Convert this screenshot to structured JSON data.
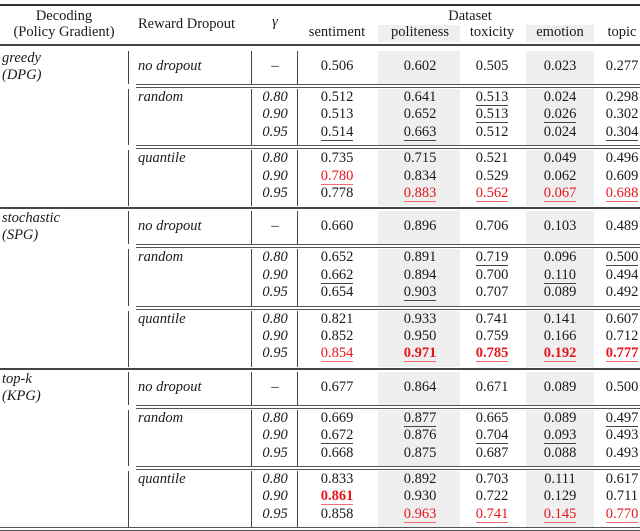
{
  "header": {
    "decoding_line1": "Decoding",
    "decoding_line2": "(Policy Gradient)",
    "reward_dropout": "Reward Dropout",
    "gamma": "γ",
    "dataset": "Dataset",
    "columns": [
      "sentiment",
      "politeness",
      "toxicity",
      "emotion",
      "topic"
    ]
  },
  "groups": [
    {
      "name": "greedy",
      "abbr": "(DPG)",
      "blocks": [
        {
          "dropout": "no dropout",
          "rows": [
            {
              "gamma": "–",
              "cells": [
                {
                  "v": "0.506"
                },
                {
                  "v": "0.602"
                },
                {
                  "v": "0.505"
                },
                {
                  "v": "0.023"
                },
                {
                  "v": "0.277"
                }
              ]
            }
          ]
        },
        {
          "dropout": "random",
          "rows": [
            {
              "gamma": "0.80",
              "cells": [
                {
                  "v": "0.512"
                },
                {
                  "v": "0.641"
                },
                {
                  "v": "0.513",
                  "ul": true
                },
                {
                  "v": "0.024"
                },
                {
                  "v": "0.298"
                }
              ]
            },
            {
              "gamma": "0.90",
              "cells": [
                {
                  "v": "0.513"
                },
                {
                  "v": "0.652"
                },
                {
                  "v": "0.513",
                  "ul": true
                },
                {
                  "v": "0.026",
                  "ul": true
                },
                {
                  "v": "0.302"
                }
              ]
            },
            {
              "gamma": "0.95",
              "cells": [
                {
                  "v": "0.514",
                  "ul": true
                },
                {
                  "v": "0.663",
                  "ul": true
                },
                {
                  "v": "0.512"
                },
                {
                  "v": "0.024"
                },
                {
                  "v": "0.304",
                  "ul": true
                }
              ]
            }
          ]
        },
        {
          "dropout": "quantile",
          "rows": [
            {
              "gamma": "0.80",
              "cells": [
                {
                  "v": "0.735"
                },
                {
                  "v": "0.715"
                },
                {
                  "v": "0.521"
                },
                {
                  "v": "0.049"
                },
                {
                  "v": "0.496"
                }
              ]
            },
            {
              "gamma": "0.90",
              "cells": [
                {
                  "v": "0.780",
                  "red": true,
                  "ul": true
                },
                {
                  "v": "0.834"
                },
                {
                  "v": "0.529"
                },
                {
                  "v": "0.062"
                },
                {
                  "v": "0.609"
                }
              ]
            },
            {
              "gamma": "0.95",
              "cells": [
                {
                  "v": "0.778"
                },
                {
                  "v": "0.883",
                  "red": true,
                  "ul": true
                },
                {
                  "v": "0.562",
                  "red": true,
                  "ul": true
                },
                {
                  "v": "0.067",
                  "red": true,
                  "ul": true
                },
                {
                  "v": "0.688",
                  "red": true,
                  "ul": true
                }
              ]
            }
          ]
        }
      ]
    },
    {
      "name": "stochastic",
      "abbr": "(SPG)",
      "blocks": [
        {
          "dropout": "no dropout",
          "rows": [
            {
              "gamma": "–",
              "cells": [
                {
                  "v": "0.660"
                },
                {
                  "v": "0.896"
                },
                {
                  "v": "0.706"
                },
                {
                  "v": "0.103"
                },
                {
                  "v": "0.489"
                }
              ]
            }
          ]
        },
        {
          "dropout": "random",
          "rows": [
            {
              "gamma": "0.80",
              "cells": [
                {
                  "v": "0.652"
                },
                {
                  "v": "0.891"
                },
                {
                  "v": "0.719",
                  "ul": true
                },
                {
                  "v": "0.096"
                },
                {
                  "v": "0.500",
                  "ul": true
                }
              ]
            },
            {
              "gamma": "0.90",
              "cells": [
                {
                  "v": "0.662",
                  "ul": true
                },
                {
                  "v": "0.894"
                },
                {
                  "v": "0.700"
                },
                {
                  "v": "0.110",
                  "ul": true
                },
                {
                  "v": "0.494"
                }
              ]
            },
            {
              "gamma": "0.95",
              "cells": [
                {
                  "v": "0.654"
                },
                {
                  "v": "0.903",
                  "ul": true
                },
                {
                  "v": "0.707"
                },
                {
                  "v": "0.089"
                },
                {
                  "v": "0.492"
                }
              ]
            }
          ]
        },
        {
          "dropout": "quantile",
          "rows": [
            {
              "gamma": "0.80",
              "cells": [
                {
                  "v": "0.821"
                },
                {
                  "v": "0.933"
                },
                {
                  "v": "0.741"
                },
                {
                  "v": "0.141"
                },
                {
                  "v": "0.607"
                }
              ]
            },
            {
              "gamma": "0.90",
              "cells": [
                {
                  "v": "0.852"
                },
                {
                  "v": "0.950"
                },
                {
                  "v": "0.759"
                },
                {
                  "v": "0.166"
                },
                {
                  "v": "0.712"
                }
              ]
            },
            {
              "gamma": "0.95",
              "cells": [
                {
                  "v": "0.854",
                  "red": true,
                  "ul": true
                },
                {
                  "v": "0.971",
                  "red": true,
                  "bold": true,
                  "ul": true
                },
                {
                  "v": "0.785",
                  "red": true,
                  "bold": true,
                  "ul": true
                },
                {
                  "v": "0.192",
                  "red": true,
                  "bold": true,
                  "ul": true
                },
                {
                  "v": "0.777",
                  "red": true,
                  "bold": true,
                  "ul": true
                }
              ]
            }
          ]
        }
      ]
    },
    {
      "name": "top-k",
      "abbr": "(KPG)",
      "blocks": [
        {
          "dropout": "no dropout",
          "rows": [
            {
              "gamma": "–",
              "cells": [
                {
                  "v": "0.677"
                },
                {
                  "v": "0.864"
                },
                {
                  "v": "0.671"
                },
                {
                  "v": "0.089"
                },
                {
                  "v": "0.500"
                }
              ]
            }
          ]
        },
        {
          "dropout": "random",
          "rows": [
            {
              "gamma": "0.80",
              "cells": [
                {
                  "v": "0.669"
                },
                {
                  "v": "0.877",
                  "ul": true
                },
                {
                  "v": "0.665"
                },
                {
                  "v": "0.089"
                },
                {
                  "v": "0.497",
                  "ul": true
                }
              ]
            },
            {
              "gamma": "0.90",
              "cells": [
                {
                  "v": "0.672",
                  "ul": true
                },
                {
                  "v": "0.876"
                },
                {
                  "v": "0.704",
                  "ul": true
                },
                {
                  "v": "0.093",
                  "ul": true
                },
                {
                  "v": "0.493"
                }
              ]
            },
            {
              "gamma": "0.95",
              "cells": [
                {
                  "v": "0.668"
                },
                {
                  "v": "0.875"
                },
                {
                  "v": "0.687"
                },
                {
                  "v": "0.088"
                },
                {
                  "v": "0.493"
                }
              ]
            }
          ]
        },
        {
          "dropout": "quantile",
          "rows": [
            {
              "gamma": "0.80",
              "cells": [
                {
                  "v": "0.833"
                },
                {
                  "v": "0.892"
                },
                {
                  "v": "0.703"
                },
                {
                  "v": "0.111"
                },
                {
                  "v": "0.617"
                }
              ]
            },
            {
              "gamma": "0.90",
              "cells": [
                {
                  "v": "0.861",
                  "red": true,
                  "bold": true,
                  "ul": true
                },
                {
                  "v": "0.930"
                },
                {
                  "v": "0.722"
                },
                {
                  "v": "0.129"
                },
                {
                  "v": "0.711"
                }
              ]
            },
            {
              "gamma": "0.95",
              "cells": [
                {
                  "v": "0.858"
                },
                {
                  "v": "0.963",
                  "red": true,
                  "ul": true
                },
                {
                  "v": "0.741",
                  "red": true,
                  "ul": true
                },
                {
                  "v": "0.145",
                  "red": true,
                  "ul": true
                },
                {
                  "v": "0.770",
                  "red": true,
                  "ul": true
                }
              ]
            }
          ]
        }
      ]
    }
  ],
  "colors": {
    "highlight_text": "#e8141c",
    "shaded_column": "#efefef"
  }
}
